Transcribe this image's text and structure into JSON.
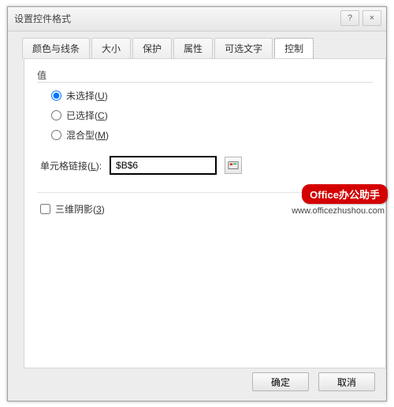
{
  "dialog": {
    "title": "设置控件格式",
    "help_tooltip": "?",
    "close_tooltip": "×"
  },
  "tabs": {
    "items": [
      {
        "label": "颜色与线条"
      },
      {
        "label": "大小"
      },
      {
        "label": "保护"
      },
      {
        "label": "属性"
      },
      {
        "label": "可选文字"
      },
      {
        "label": "控制"
      }
    ],
    "active_index": 5
  },
  "group": {
    "value_legend": "值",
    "radios": [
      {
        "label": "未选择",
        "accel": "U"
      },
      {
        "label": "已选择",
        "accel": "C"
      },
      {
        "label": "混合型",
        "accel": "M"
      }
    ],
    "selected_radio": 0,
    "cell_link_label": "单元格链接",
    "cell_link_accel": "L",
    "cell_link_value": "$B$6",
    "shadow_label": "三维阴影",
    "shadow_accel": "3",
    "shadow_checked": false
  },
  "buttons": {
    "ok": "确定",
    "cancel": "取消"
  },
  "watermark": {
    "badge": "Office办公助手",
    "url": "www.officezhushou.com"
  }
}
